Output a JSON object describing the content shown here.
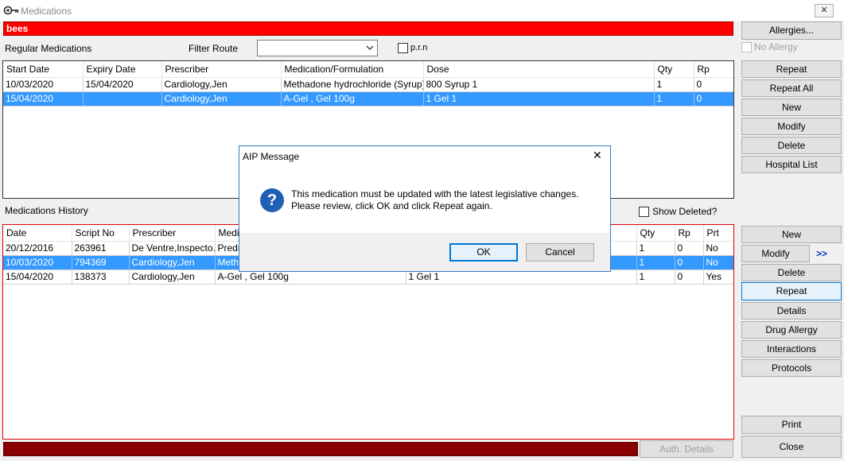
{
  "window": {
    "title": "Medications",
    "close_glyph": "✕"
  },
  "alert_text": "bees",
  "regular": {
    "heading": "Regular Medications",
    "filter_label": "Filter Route",
    "filter_value": "",
    "prn_label": "p.r.n",
    "columns": [
      "Start Date",
      "Expiry Date",
      "Prescriber",
      "Medication/Formulation",
      "Dose",
      "Qty",
      "Rp"
    ],
    "rows": [
      [
        "10/03/2020",
        "15/04/2020",
        "Cardiology,Jen",
        "Methadone hydrochloride (Syrup) ...",
        "800 Syrup 1",
        "1",
        "0"
      ],
      [
        "15/04/2020",
        "",
        "Cardiology,Jen",
        "A-Gel , Gel 100g",
        "1 Gel 1",
        "1",
        "0"
      ]
    ],
    "selected_row": 1
  },
  "history": {
    "heading": "Medications History",
    "show_deleted_label": "Show Deleted?",
    "columns": [
      "Date",
      "Script No",
      "Prescriber",
      "Medi",
      "",
      "Qty",
      "Rp",
      "Prt"
    ],
    "rows": [
      [
        "20/12/2016",
        "263961",
        "De Ventre,Inspecto...",
        "Predn",
        "",
        "1",
        "0",
        "No"
      ],
      [
        "10/03/2020",
        "794369",
        "Cardiology,Jen",
        "Metha",
        "",
        "1",
        "0",
        "No"
      ],
      [
        "15/04/2020",
        "138373",
        "Cardiology,Jen",
        "A-Gel , Gel 100g",
        "1 Gel 1",
        "1",
        "0",
        "Yes"
      ]
    ],
    "selected_row": 1
  },
  "right_top": {
    "allergies": "Allergies...",
    "no_allergy": "No Allergy",
    "buttons": [
      "Repeat",
      "Repeat All",
      "New",
      "Modify",
      "Delete",
      "Hospital List"
    ]
  },
  "right_bottom": {
    "new": "New",
    "modify": "Modify",
    "more": ">>",
    "delete": "Delete",
    "repeat": "Repeat",
    "details": "Details",
    "drug_allergy": "Drug Allergy",
    "interactions": "Interactions",
    "protocols": "Protocols",
    "print": "Print",
    "close": "Close",
    "auth_details": "Auth. Details"
  },
  "dialog": {
    "title": "AIP Message",
    "close_glyph": "✕",
    "icon_glyph": "?",
    "message_line1": "This medication must be updated with the latest legislative changes.",
    "message_line2": "Please review, click OK and click Repeat again.",
    "ok": "OK",
    "cancel": "Cancel"
  },
  "colors": {
    "alert": "#ff0000",
    "selection": "#3399ff",
    "status_bar": "#8b0000",
    "history_border": "#e00000",
    "dialog_icon": "#1f5fb5"
  }
}
